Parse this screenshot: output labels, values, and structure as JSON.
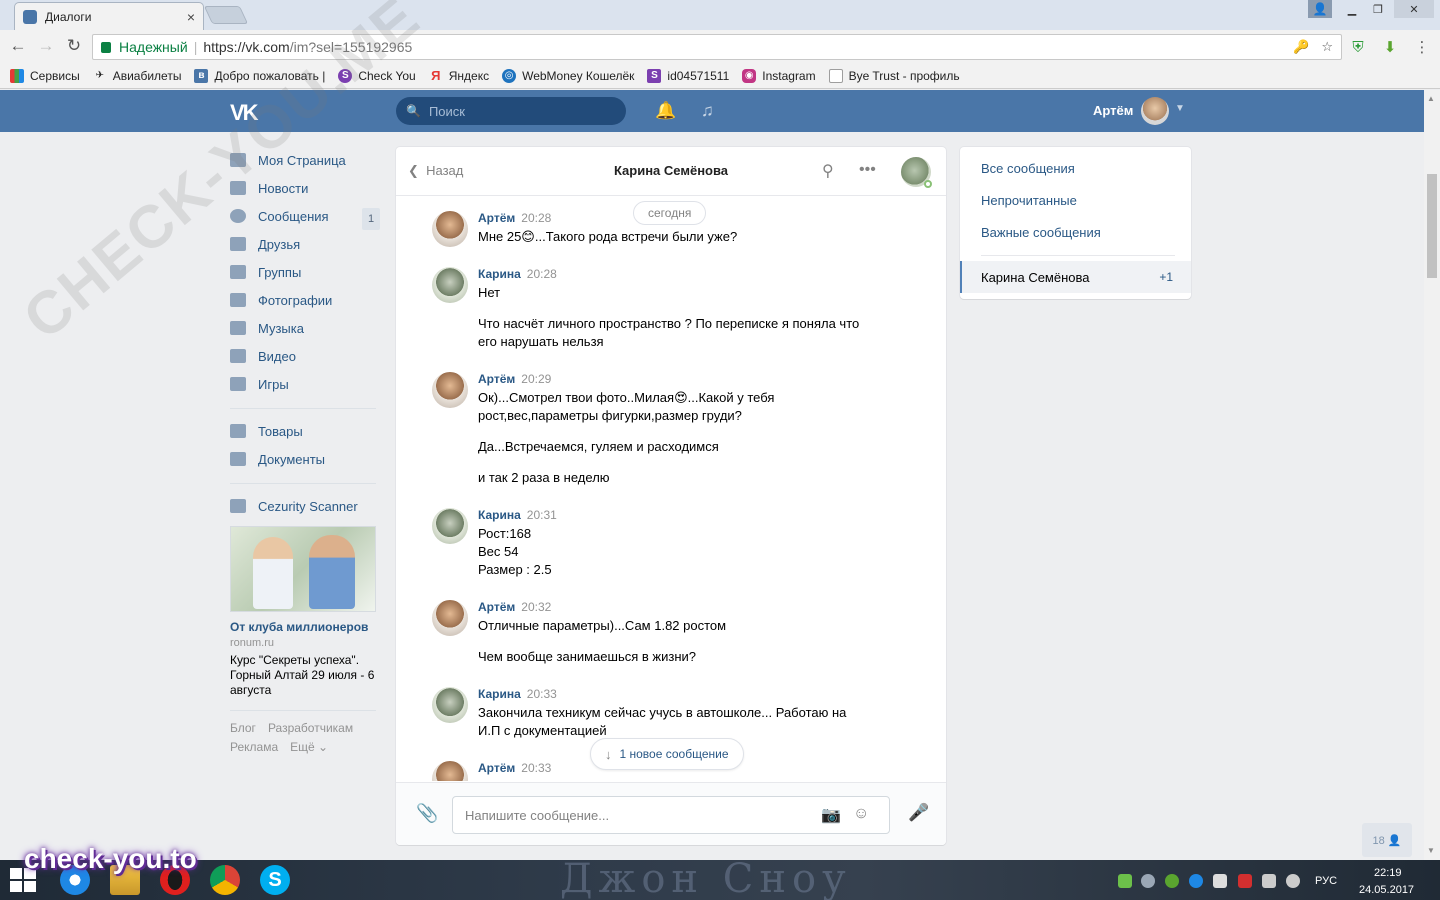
{
  "browser": {
    "tab_title": "Диалоги",
    "tab_close": "×",
    "secure_label": "Надежный",
    "url_host": "https://vk.com",
    "url_path": "/im?sel=155192965",
    "bookmarks": [
      {
        "label": "Сервисы",
        "color": "#e53935"
      },
      {
        "label": "Авиабилеты",
        "color": "#222222"
      },
      {
        "label": "Добро пожаловать |",
        "color": "#4a76a8"
      },
      {
        "label": "Check You",
        "color": "#7b3fb0"
      },
      {
        "label": "Яндекс",
        "color": "#e53935"
      },
      {
        "label": "WebMoney Кошелёк",
        "color": "#1e73be"
      },
      {
        "label": "id04571511",
        "color": "#7b3fb0"
      },
      {
        "label": "Instagram",
        "color": "#c13584"
      },
      {
        "label": "Bye Trust - профиль",
        "color": "#9e9e9e"
      }
    ]
  },
  "vk": {
    "logo": "VK",
    "search_placeholder": "Поиск",
    "user_name": "Артём"
  },
  "sidebar": {
    "items": [
      {
        "label": "Моя Страница",
        "icon": "home-icon"
      },
      {
        "label": "Новости",
        "icon": "news-icon"
      },
      {
        "label": "Сообщения",
        "icon": "messages-icon",
        "badge": "1"
      },
      {
        "label": "Друзья",
        "icon": "friends-icon"
      },
      {
        "label": "Группы",
        "icon": "groups-icon"
      },
      {
        "label": "Фотографии",
        "icon": "photos-icon"
      },
      {
        "label": "Музыка",
        "icon": "music-icon"
      },
      {
        "label": "Видео",
        "icon": "video-icon"
      },
      {
        "label": "Игры",
        "icon": "games-icon"
      }
    ],
    "items2": [
      {
        "label": "Товары",
        "icon": "goods-icon"
      },
      {
        "label": "Документы",
        "icon": "documents-icon"
      }
    ],
    "items3": [
      {
        "label": "Cezurity Scanner",
        "icon": "app-icon"
      }
    ],
    "ad": {
      "title": "От клуба миллионеров",
      "domain": "ronum.ru",
      "text": "Курс \"Секреты успеха\". Горный Алтай 29 июля - 6 августа"
    },
    "footer": [
      "Блог",
      "Разработчикам",
      "Реклама",
      "Ещё ⌄"
    ]
  },
  "chat": {
    "back_label": "Назад",
    "title": "Карина Семёнова",
    "date_label": "сегодня",
    "messages": [
      {
        "author": "Артём",
        "time": "20:28",
        "lines": [
          "Мне 25😊...Такого рода встречи были уже?"
        ]
      },
      {
        "author": "Карина",
        "time": "20:28",
        "lines": [
          "Нет",
          "Что насчёт личного пространство ? По переписке я поняла что его нарушать нельзя"
        ]
      },
      {
        "author": "Артём",
        "time": "20:29",
        "lines": [
          "Ок)...Смотрел твои фото..Милая😍...Какой у тебя рост,вес,параметры фигурки,размер груди?",
          "Да...Встречаемся, гуляем и расходимся",
          "и так 2 раза в неделю"
        ]
      },
      {
        "author": "Карина",
        "time": "20:31",
        "lines": [
          "Рост:168<br>Вес 54<br>Размер : 2.5"
        ]
      },
      {
        "author": "Артём",
        "time": "20:32",
        "lines": [
          "Отличные параметры)...Сам 1.82 ростом",
          "Чем вообще занимаешься в жизни?"
        ]
      },
      {
        "author": "Карина",
        "time": "20:33",
        "lines": [
          "Закончила техникум сейчас учусь в автошколе... Работаю на И.П с документацией"
        ]
      },
      {
        "author": "Артём",
        "time": "20:33",
        "lines": [
          ""
        ]
      }
    ],
    "new_message_label": "1 новое сообщение",
    "composer_placeholder": "Напишите сообщение..."
  },
  "filters": {
    "all": "Все сообщения",
    "unread": "Непрочитанные",
    "important": "Важные сообщения",
    "active_name": "Карина Семёнова",
    "active_count": "+1"
  },
  "misc": {
    "bottom_badge": "18 👤"
  },
  "taskbar": {
    "lang": "РУС",
    "time": "22:19",
    "date": "24.05.2017",
    "wallpaper_text": "Джон Сноу"
  },
  "watermarks": {
    "diagonal": "CHECK-YOU.ME",
    "corner": "check-you.to"
  }
}
